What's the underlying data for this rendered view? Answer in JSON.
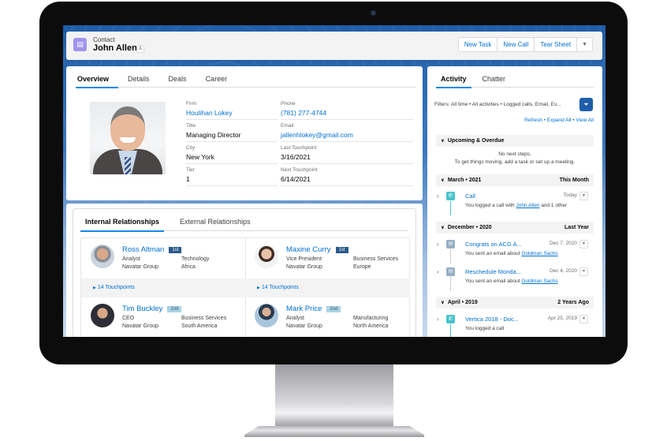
{
  "header": {
    "object_type": "Contact",
    "record_name": "John Allen",
    "icon": "contact-card-icon",
    "hierarchy_icon": "hierarchy-icon",
    "actions": [
      "New Task",
      "New Call",
      "Tear Sheet"
    ],
    "more_icon": "chevron-down-icon"
  },
  "overview": {
    "tabs": [
      "Overview",
      "Details",
      "Deals",
      "Career"
    ],
    "active_tab": "Overview",
    "fields": {
      "firm": {
        "label": "Firm",
        "value": "Houlihan Lokey"
      },
      "title": {
        "label": "Title",
        "value": "Managing Director"
      },
      "city": {
        "label": "City",
        "value": "New York"
      },
      "tier": {
        "label": "Tier",
        "value": "1"
      },
      "phone": {
        "label": "Phone",
        "value": "(781) 277-4744"
      },
      "email": {
        "label": "Email",
        "value": "jallenhlokey@gmail.com"
      },
      "last_touchpoint": {
        "label": "Last Touchpoint",
        "value": "3/16/2021"
      },
      "next_touchpoint": {
        "label": "Next Touchpoint",
        "value": "6/14/2021"
      }
    }
  },
  "relationships": {
    "tabs": [
      "Internal Relationships",
      "External Relationships"
    ],
    "active_tab": "Internal Relationships",
    "people": [
      {
        "name": "Ross Altman",
        "degree": "1st",
        "title": "Analyst",
        "company": "Navatar Group",
        "industry": "Technology",
        "region": "Africa",
        "touchpoints": "14 Touchpoints"
      },
      {
        "name": "Maxine Curry",
        "degree": "1st",
        "title": "Vice President",
        "company": "Navatar Group",
        "industry": "Business Services",
        "region": "Europe",
        "touchpoints": "14 Touchpoints"
      },
      {
        "name": "Tim Buckley",
        "degree": "2nd",
        "title": "CEO",
        "company": "Navatar Group",
        "industry": "Business Services",
        "region": "South America"
      },
      {
        "name": "Mark Price",
        "degree": "2nd",
        "title": "Analyst",
        "company": "Navatar Group",
        "industry": "Manufacturing",
        "region": "North America"
      }
    ]
  },
  "activity": {
    "tabs": [
      "Activity",
      "Chatter"
    ],
    "active_tab": "Activity",
    "filters_text": "Filters: All time • All activities • Logged calls, Email, Ev...",
    "filter_icon": "filter-icon",
    "links": {
      "refresh": "Refresh",
      "sep": " • ",
      "expand_all": "Expand All",
      "view_all": "View All"
    },
    "upcoming": {
      "label": "Upcoming & Overdue",
      "empty_line1": "No next steps.",
      "empty_line2": "To get things moving, add a task or set up a meeting."
    },
    "sections": [
      {
        "label": "March • 2021",
        "right": "This Month",
        "items": [
          {
            "type": "call",
            "title": "Call",
            "date": "Today",
            "desc_prefix": "You logged a call with ",
            "desc_link": "John Allen",
            "desc_suffix": " and 1 other"
          }
        ]
      },
      {
        "label": "December • 2020",
        "right": "Last Year",
        "items": [
          {
            "type": "email",
            "title": "Congrats on ACG A...",
            "date": "Dec 7, 2020",
            "desc_prefix": "You sent an email about ",
            "desc_link": "Goldman Sachs",
            "desc_suffix": ""
          },
          {
            "type": "email",
            "title": "Reschedule Monda...",
            "date": "Dec 4, 2020",
            "desc_prefix": "You sent an email about ",
            "desc_link": "Goldman Sachs",
            "desc_suffix": ""
          }
        ]
      },
      {
        "label": "April • 2019",
        "right": "2 Years Ago",
        "items": [
          {
            "type": "call",
            "title": "Vertica 2018 - Doc...",
            "date": "Apr 25, 2019",
            "desc_prefix": "You logged a call",
            "desc_link": "",
            "desc_suffix": ""
          }
        ]
      }
    ]
  },
  "colors": {
    "brand_blue": "#0070d2",
    "contact_icon": "#a094ed",
    "call_icon": "#48c3cc",
    "email_icon": "#95aec5",
    "badge_1st": "#2a5a8a",
    "badge_2nd": "#aad3e6"
  }
}
